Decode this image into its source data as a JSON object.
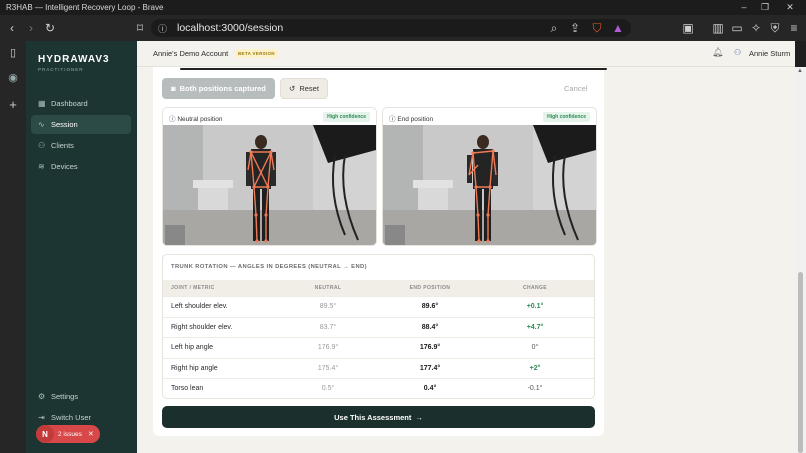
{
  "window": {
    "title": "R3HAB — Intelligent Recovery Loop - Brave"
  },
  "browser": {
    "url": "localhost:3000/session"
  },
  "sidebar": {
    "brand": "HYDRAWAV3",
    "brand_sub": "PRACTITIONER",
    "items": [
      {
        "label": "Dashboard",
        "icon": "grid-icon"
      },
      {
        "label": "Session",
        "icon": "pulse-icon"
      },
      {
        "label": "Clients",
        "icon": "users-icon"
      },
      {
        "label": "Devices",
        "icon": "wifi-icon"
      }
    ],
    "bottom_items": [
      {
        "label": "Settings",
        "icon": "gear-icon"
      },
      {
        "label": "Switch User",
        "icon": "logout-icon"
      }
    ],
    "issues": {
      "letter": "N",
      "label": "2 issues"
    }
  },
  "header": {
    "account": "Annie's Demo Account",
    "beta": "BETA VERSION",
    "user": "Annie Sturm"
  },
  "capture": {
    "captured_label": "Both positions captured",
    "reset_label": "Reset",
    "cancel_label": "Cancel"
  },
  "photos": [
    {
      "label": "Neutral position",
      "confidence": "High confidence"
    },
    {
      "label": "End position",
      "confidence": "High confidence"
    }
  ],
  "table": {
    "title": "TRUNK ROTATION — ANGLES IN DEGREES (NEUTRAL → END)",
    "headers": [
      "JOINT / METRIC",
      "NEUTRAL",
      "END POSITION",
      "CHANGE"
    ],
    "rows": [
      {
        "name": "Left shoulder elev.",
        "neutral": "89.5°",
        "end": "89.6°",
        "change": "+0.1°",
        "status": "positive"
      },
      {
        "name": "Right shoulder elev.",
        "neutral": "83.7°",
        "end": "88.4°",
        "change": "+4.7°",
        "status": "positive"
      },
      {
        "name": "Left hip angle",
        "neutral": "176.9°",
        "end": "176.9°",
        "change": "0°",
        "status": "neutral"
      },
      {
        "name": "Right hip angle",
        "neutral": "175.4°",
        "end": "177.4°",
        "change": "+2°",
        "status": "positive"
      },
      {
        "name": "Torso lean",
        "neutral": "0.5°",
        "end": "0.4°",
        "change": "-0.1°",
        "status": "neutral"
      }
    ]
  },
  "actions": {
    "use_label": "Use This Assessment"
  },
  "colors": {
    "sidebar_bg": "#1d3532",
    "positive": "#2f8a55",
    "primary_button": "#1b302d"
  }
}
